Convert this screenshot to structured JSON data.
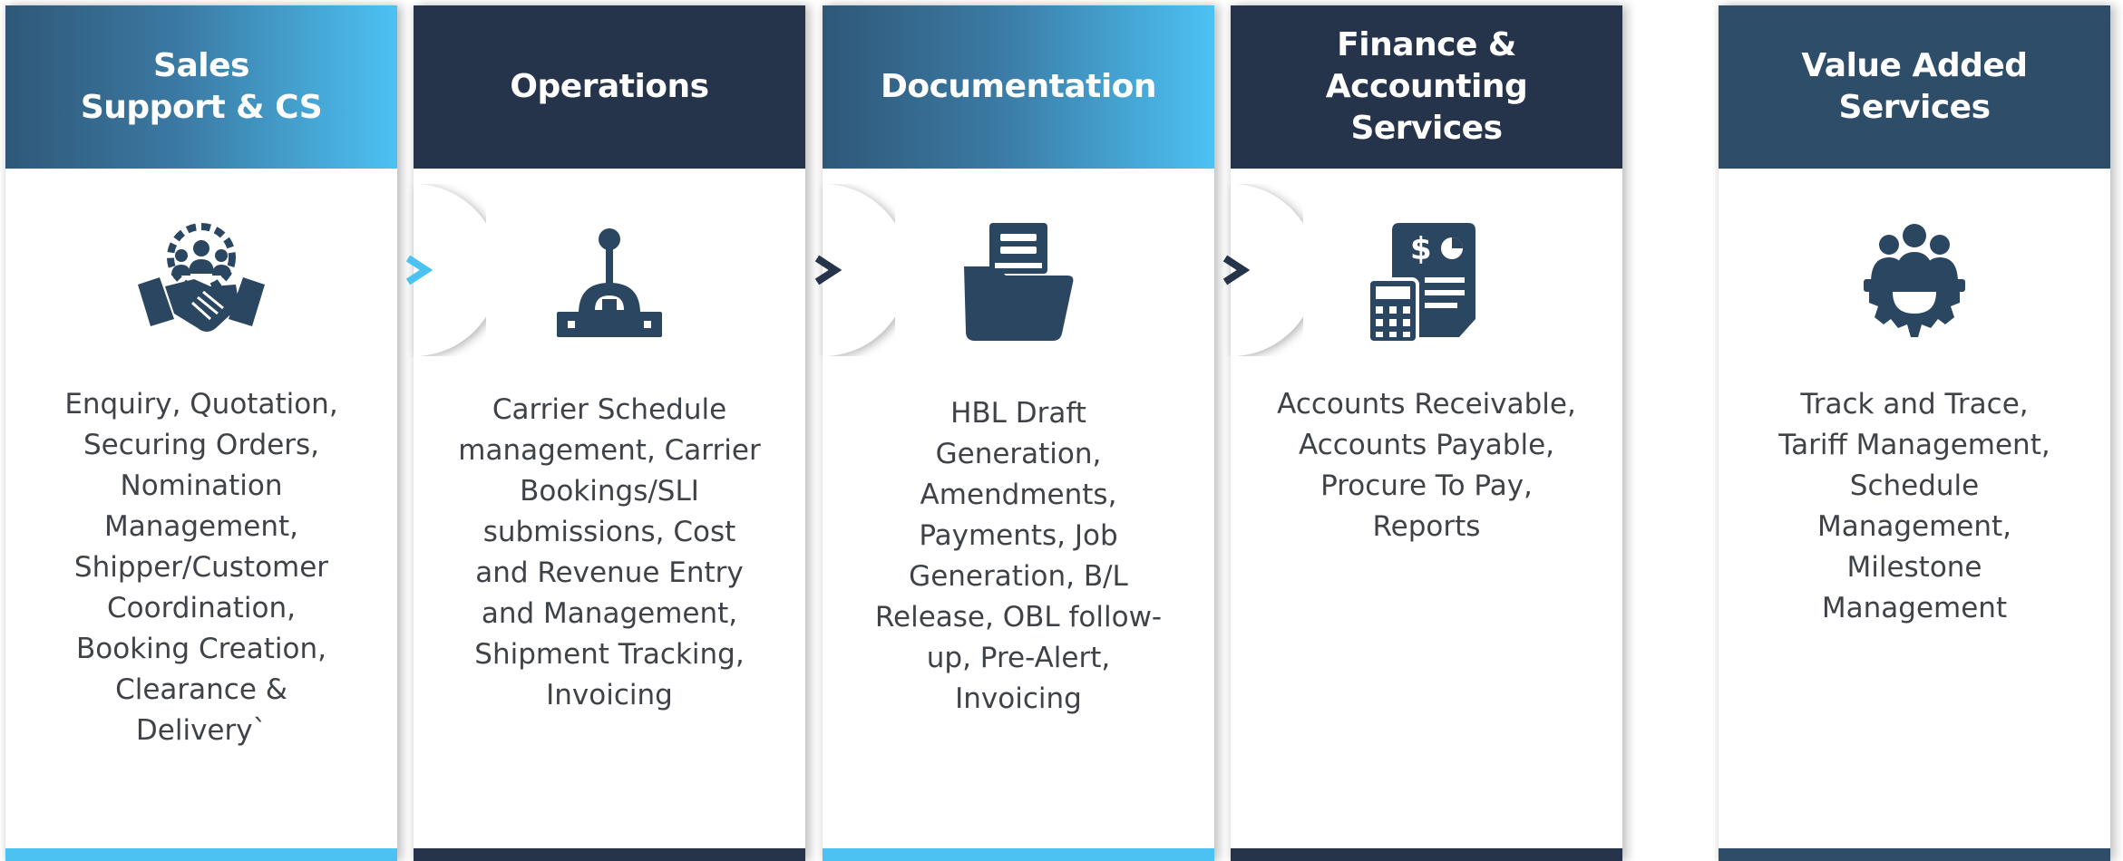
{
  "columns": [
    {
      "title": "Sales\nSupport & CS",
      "icon": "handshake-team-icon",
      "description": "Enquiry, Quotation,\nSecuring Orders,\nNomination\nManagement,\nShipper/Customer\nCoordination,\nBooking Creation,\nClearance &\nDelivery`"
    },
    {
      "title": "Operations",
      "icon": "joystick-control-icon",
      "description": "Carrier Schedule\nmanagement, Carrier\nBookings/SLI\nsubmissions, Cost\nand Revenue Entry\nand Management,\nShipment Tracking,\nInvoicing"
    },
    {
      "title": "Documentation",
      "icon": "document-folder-icon",
      "description": "HBL Draft\nGeneration,\nAmendments,\nPayments, Job\nGeneration, B/L\nRelease, OBL follow-\nup, Pre-Alert,\nInvoicing"
    },
    {
      "title": "Finance &\nAccounting\nServices",
      "icon": "calculator-invoice-icon",
      "description": "Accounts Receivable,\nAccounts Payable,\nProcure To Pay,\nReports"
    },
    {
      "title": "Value Added\nServices",
      "icon": "team-gear-icon",
      "description": "Track and Trace,\nTariff Management,\nSchedule\nManagement,\nMilestone\nManagement"
    }
  ],
  "arrows": [
    {
      "icon": "chevron-right-icon",
      "color": "#4cc2f3"
    },
    {
      "icon": "chevron-right-icon",
      "color": "#25344a"
    },
    {
      "icon": "chevron-right-icon",
      "color": "#25344a"
    }
  ],
  "colors": {
    "dark_navy": "#25344a",
    "slate_blue": "#2e4d68",
    "light_blue": "#4cc2f3",
    "icon_color": "#2b4660",
    "text_gray": "#3f4347"
  }
}
